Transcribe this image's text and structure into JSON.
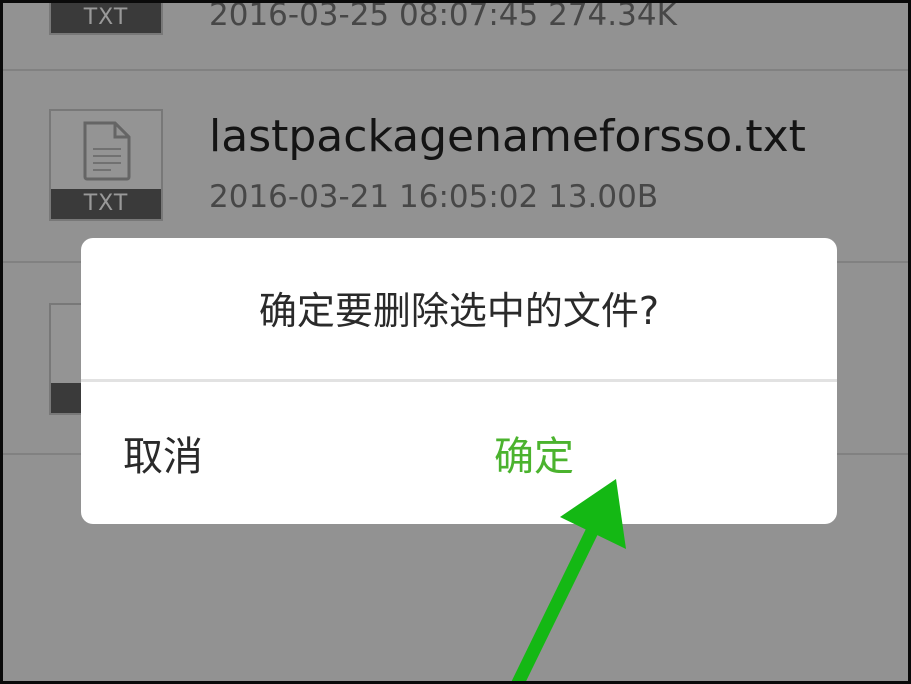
{
  "file_list": {
    "items": [
      {
        "ext_label": "TXT",
        "name": "",
        "meta": "2016-03-25 08:07:45 274.34K"
      },
      {
        "ext_label": "TXT",
        "name": "lastpackagenameforsso.txt",
        "meta": "2016-03-21 16:05:02 13.00B"
      },
      {
        "ext_label": "",
        "name": "",
        "meta": ""
      }
    ]
  },
  "dialog": {
    "message": "确定要删除选中的文件?",
    "cancel_label": "取消",
    "confirm_label": "确定"
  },
  "colors": {
    "confirm": "#4bb32e",
    "arrow": "#14b814",
    "ext_label_bg": "#616161"
  },
  "icons": {
    "file": "document-icon",
    "annotation": "arrow-annotation"
  }
}
